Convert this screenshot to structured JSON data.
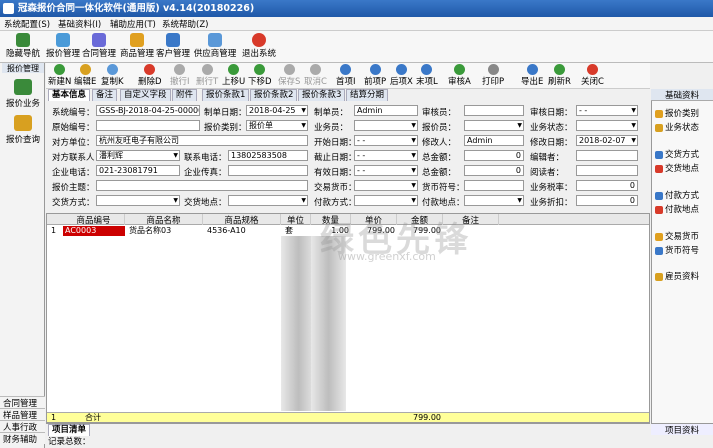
{
  "window": {
    "title": "冠森报价合同一体化软件(通用版) v4.14(20180226)"
  },
  "menu": [
    "系统配置(S)",
    "基础资料(I)",
    "辅助应用(T)",
    "系统帮助(Z)"
  ],
  "top_toolbar": [
    "隐藏导航",
    "报价管理",
    "合同管理",
    "商品管理",
    "客户管理",
    "供应商管理",
    "退出系统"
  ],
  "sidebar": {
    "section": "报价管理",
    "items": [
      "报价业务",
      "报价查询"
    ],
    "bottom": [
      "合同管理",
      "样品管理",
      "人事行政",
      "财务辅助"
    ]
  },
  "toolbar": [
    "新建N",
    "编辑E",
    "复制K",
    "删除D",
    "撤行I",
    "删行T",
    "上移U",
    "下移D",
    "保存S",
    "取消C",
    "首项I",
    "前项P",
    "后项X",
    "末项L",
    "审核A",
    "打印P",
    "导出E",
    "刷新R",
    "关闭C"
  ],
  "tabs": [
    "基本信息",
    "备注",
    "自定义字段",
    "附件",
    "报价条款1",
    "报价条款2",
    "报价条款3",
    "结算分期"
  ],
  "form": {
    "l_code": "系统编号：",
    "v_code": "GSS-BJ-2018-04-25-000009",
    "l_date": "制单日期：",
    "v_date": "2018-04-25",
    "l_maker": "制单员：",
    "v_maker": "Admin",
    "l_auditor": "审核员：",
    "v_auditor": "",
    "l_auditdate": "审核日期：",
    "v_auditdate": "- -",
    "l_orig": "原始编号：",
    "v_orig": "",
    "l_qtype": "报价类别：",
    "v_qtype": "报价单",
    "l_sales": "业务员：",
    "v_sales": "",
    "l_quoter": "报价员：",
    "v_quoter": "",
    "l_status": "业务状态：",
    "v_status": "",
    "l_party": "对方单位：",
    "v_party": "杭州友旺电子有限公司",
    "l_start": "开始日期：",
    "v_start": "- -",
    "l_modifier": "修改人：",
    "v_modifier": "Admin",
    "l_moddate": "修改日期：",
    "v_moddate": "2018-02-07",
    "l_contact": "对方联系人：",
    "v_contact": "潘利辉",
    "l_phone": "联系电话：",
    "v_phone": "13802583508",
    "l_deadline": "截止日期：",
    "v_deadline": "- -",
    "l_amount": "总金额：",
    "v_amount": "0",
    "l_quoter2": "编辑者：",
    "v_quoter2": "",
    "l_tel": "企业电话：",
    "v_tel": "021-23081791",
    "l_fax": "企业传真：",
    "v_fax": "",
    "l_valid": "有效日期：",
    "v_valid": "- -",
    "l_disc": "总金额：",
    "v_disc": "0",
    "l_reader": "阅读者：",
    "v_reader": "",
    "l_subject": "报价主题：",
    "v_subject": "",
    "l_currency": "交易货币：",
    "v_currency": "",
    "l_cursym": "货币符号：",
    "v_cursym": "",
    "l_tax": "业务税率：",
    "v_tax": "0",
    "l_trade": "交货方式：",
    "v_trade": "",
    "l_place": "交货地点：",
    "v_place": "",
    "l_pay": "付款方式：",
    "v_pay": "",
    "l_payplace": "付款地点：",
    "v_payplace": "",
    "l_rate": "业务折扣：",
    "v_rate": "0"
  },
  "grid": {
    "headers": [
      "商品编号",
      "商品名称",
      "商品规格",
      "单位",
      "数量",
      "单价",
      "金额",
      "备注"
    ],
    "rows": [
      {
        "idx": "1",
        "code": "AC0003",
        "name": "货品名称03",
        "spec": "4536-A10",
        "unit": "套",
        "qty": "1.00",
        "price": "799.00",
        "amount": "799.00",
        "note": ""
      }
    ],
    "footer": {
      "idx": "1",
      "label": "合计",
      "amount": "799.00"
    }
  },
  "bottom_tabs": [
    "项目清单"
  ],
  "status": "记录总数：",
  "right_panel": {
    "title": "基础资料",
    "items": [
      "报价类别",
      "业务状态",
      "交货方式",
      "交货地点",
      "付款方式",
      "付款地点",
      "交易货币",
      "货币符号",
      "雇员资料"
    ],
    "bottom": "项目资料"
  },
  "watermark": {
    "big": "绿色先锋",
    "small": "www.greenxf.com"
  }
}
